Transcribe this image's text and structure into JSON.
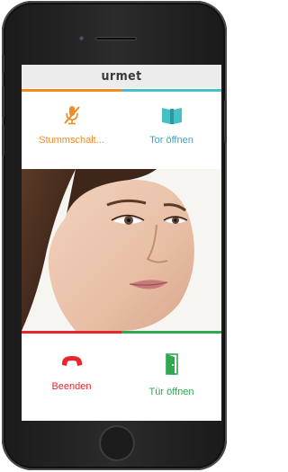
{
  "header": {
    "brand": "urmet"
  },
  "actions": {
    "mute_label": "Stummschalt...",
    "open_gate_label": "Tor öffnen",
    "end_call_label": "Beenden",
    "open_door_label": "Tür öffnen"
  },
  "icons": {
    "mute": "microphone-muted-icon",
    "gate": "gate-icon",
    "end_call": "phone-hangup-icon",
    "door": "door-icon"
  },
  "colors": {
    "orange_accent": "#f08a24",
    "teal_accent": "#45c0c4",
    "red_accent": "#e8262b",
    "green_accent": "#2fa84f",
    "mute_text": "#f08a24",
    "gate_text": "#3aa6ba",
    "end_text": "#e8262b",
    "door_text": "#2fa84f"
  }
}
